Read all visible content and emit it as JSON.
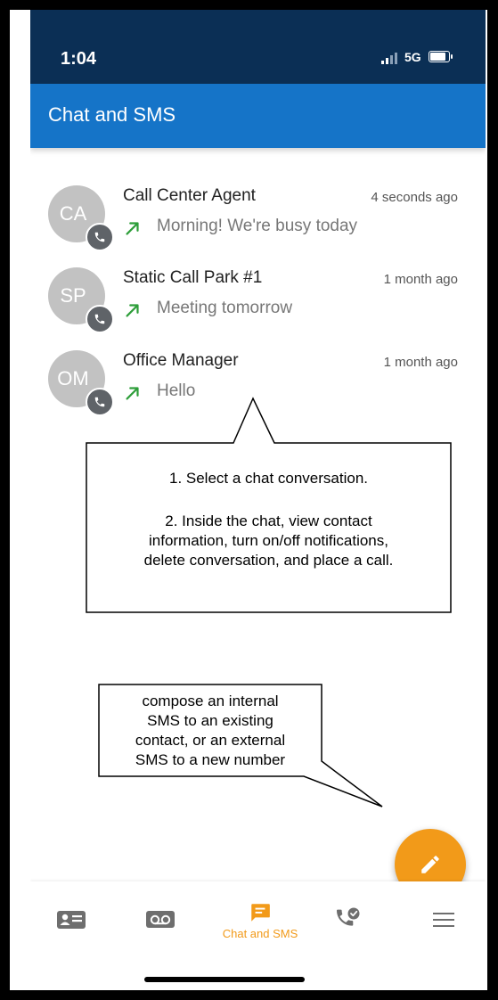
{
  "status_bar": {
    "time": "1:04",
    "network": "5G"
  },
  "app_bar": {
    "title": "Chat and SMS"
  },
  "conversations": [
    {
      "initials": "CA",
      "name": "Call Center Agent",
      "time": "4 seconds ago",
      "last_message": "Morning! We're busy today"
    },
    {
      "initials": "SP",
      "name": "Static Call Park #1",
      "time": "1 month ago",
      "last_message": "Meeting tomorrow"
    },
    {
      "initials": "OM",
      "name": "Office Manager",
      "time": "1 month ago",
      "last_message": "Hello"
    }
  ],
  "callouts": {
    "select": {
      "line1": "1. Select a chat conversation.",
      "line2": "2. Inside the chat, view contact",
      "line3": "information, turn on/off notifications,",
      "line4": "delete conversation, and place a call."
    },
    "compose": {
      "line1": "compose an internal",
      "line2": "SMS to an existing",
      "line3": "contact, or an external",
      "line4": "SMS to a new number"
    }
  },
  "bottom_nav": {
    "items": [
      {
        "icon": "contacts-card-icon",
        "label": ""
      },
      {
        "icon": "voicemail-icon",
        "label": ""
      },
      {
        "icon": "chat-icon",
        "label": "Chat and SMS",
        "active": true
      },
      {
        "icon": "call-history-icon",
        "label": ""
      },
      {
        "icon": "menu-icon",
        "label": ""
      }
    ]
  },
  "colors": {
    "header": "#0b2f55",
    "app_bar": "#1574c8",
    "accent": "#f29a19",
    "outgoing_arrow": "#2e9e3a"
  }
}
